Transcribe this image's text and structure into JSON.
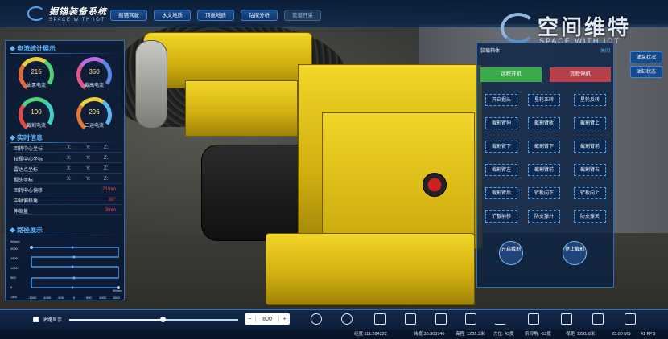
{
  "app": {
    "title": "掘锚装备系统",
    "subtitle": "SPACE WITH IOT"
  },
  "nav": [
    "掘锚驾驶",
    "水文地质",
    "顶板地质",
    "钻探分析",
    "管道开采"
  ],
  "brand": {
    "cn": "空间维特",
    "en": "SPACE WITH IOT"
  },
  "left": {
    "current_title": "电流统计展示",
    "gauges": [
      {
        "value": "215",
        "label": "油泵电流"
      },
      {
        "value": "350",
        "label": "截高电流"
      },
      {
        "value": "190",
        "label": "截割电流"
      },
      {
        "value": "296",
        "label": "二运电流"
      }
    ],
    "realtime_title": "实时信息",
    "coords": [
      {
        "label": "回转中心坐标",
        "x": "X:",
        "y": "Y:",
        "z": "Z:"
      },
      {
        "label": "较摆中心坐标",
        "x": "X:",
        "y": "Y:",
        "z": "Z:"
      },
      {
        "label": "雷达点坐标",
        "x": "X:",
        "y": "Y:",
        "z": "Z:"
      },
      {
        "label": "掘头坐标",
        "x": "X:",
        "y": "Y:",
        "z": "Z:"
      }
    ],
    "values": [
      {
        "label": "回转中心偏移",
        "value": "21mm"
      },
      {
        "label": "中轴偏移角",
        "value": "30°"
      },
      {
        "label": "伸缩量",
        "value": "3mm"
      }
    ],
    "path_title": "路径展示",
    "path_yticks": [
      "2000",
      "1500",
      "1000",
      "500",
      "0",
      "-500"
    ],
    "path_xticks": [
      "-1500",
      "-1000",
      "-500",
      "0",
      "500",
      "1000",
      "1500"
    ],
    "path_ylabel": "W/mm",
    "path_xlabel": "W/mm"
  },
  "control": {
    "head": "装载箱体",
    "link": "关闭",
    "start": "远程开机",
    "stop": "远程停机",
    "buttons": [
      "开启掘头",
      "星轮正转",
      "星轮反转",
      "截割臂伸",
      "截割臂收",
      "截割臂上",
      "截割臂下",
      "截割臂下",
      "截割臂前",
      "截割臂左",
      "截割臂前",
      "截割臂右",
      "截割臂后",
      "铲板向下",
      "铲板向上",
      "铲板前移",
      "防支撑升",
      "防支撑关"
    ],
    "open_cut": "开启截割",
    "stop_cut": "停止截割"
  },
  "side": [
    "油泵状况",
    "油缸状态"
  ],
  "bottom": {
    "check_label": "油路显示",
    "slider_value": 0.55,
    "stepper_minus": "−",
    "stepper_value": "800",
    "stepper_plus": "+"
  },
  "status": [
    "经度:111.284222",
    "纬度:36.303746",
    "高程: 1231.3米",
    "方位: 43度",
    "俯仰角: -12度",
    "视距: 1231.8米",
    "23.00 MS",
    "41 FPS"
  ],
  "colors": {
    "accent": "#59b6ff",
    "start": "#3caa4a",
    "stop": "#b8404a",
    "warn": "#ff4444"
  }
}
